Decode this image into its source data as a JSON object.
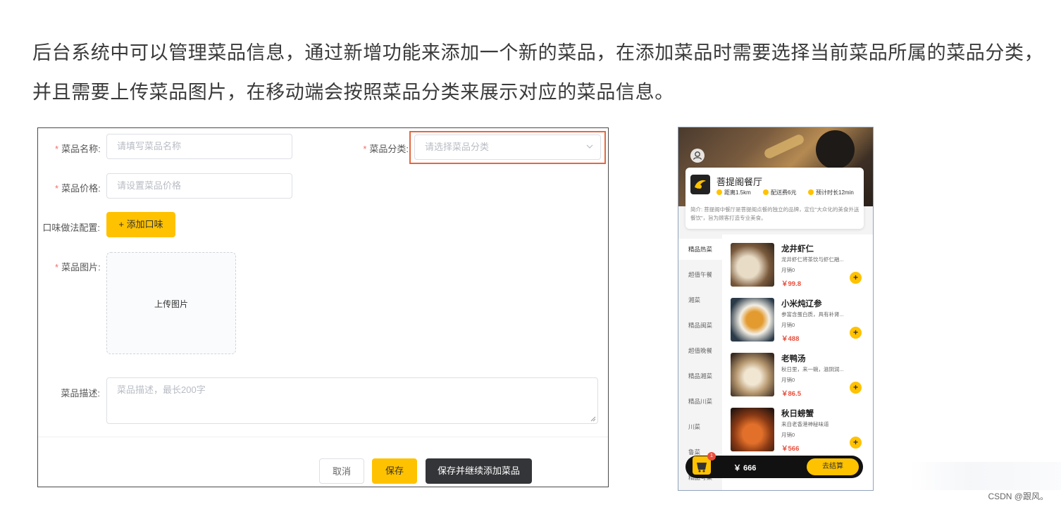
{
  "intro": {
    "line1": "后台系统中可以管理菜品信息，通过新增功能来添加一个新的菜品，在添加菜品时需要选择当前菜品所属的菜品分类，",
    "line2": "并且需要上传菜品图片，在移动端会按照菜品分类来展示对应的菜品信息。"
  },
  "form": {
    "name_label": "菜品名称:",
    "name_placeholder": "请填写菜品名称",
    "category_label": "菜品分类:",
    "category_placeholder": "请选择菜品分类",
    "price_label": "菜品价格:",
    "price_placeholder": "请设置菜品价格",
    "flavor_label": "口味做法配置:",
    "add_flavor_button": "+ 添加口味",
    "image_label": "菜品图片:",
    "upload_text": "上传图片",
    "desc_label": "菜品描述:",
    "desc_placeholder": "菜品描述，最长200字",
    "cancel_button": "取消",
    "save_button": "保存",
    "save_continue_button": "保存并继续添加菜品",
    "required_mark": "*"
  },
  "mobile": {
    "shop_name": "菩提阁餐厅",
    "distance": "距离1.5km",
    "delivery_fee": "配送费6元",
    "eta": "预计时长12min",
    "intro_text": "简介: 菩提阁中餐厅是菩提阁点餐的独立的品牌，定位\"大众化的美食外送餐饮\"，旨为顾客打造专业美食。",
    "categories": [
      "精品热菜",
      "超值午餐",
      "湘菜",
      "精品闽菜",
      "超值晚餐",
      "精品湘菜",
      "精品川菜",
      "川菜",
      "鲁菜",
      "精品粤菜"
    ],
    "dishes": [
      {
        "name": "龙井虾仁",
        "desc": "龙井虾仁将茶饮与虾仁融...",
        "sold": "月销0",
        "price": "￥99.8"
      },
      {
        "name": "小米炖辽参",
        "desc": "参富含蛋白质，具有补肾...",
        "sold": "月销0",
        "price": "￥488"
      },
      {
        "name": "老鸭汤",
        "desc": "秋日里，来一碗，滋阴润...",
        "sold": "月销0",
        "price": "￥86.5"
      },
      {
        "name": "秋日螃蟹",
        "desc": "来自老香港神秘味道",
        "sold": "月销0",
        "price": "￥566"
      }
    ],
    "plus_symbol": "+",
    "cart_count": "1",
    "cart_total": "￥ 666",
    "checkout_button": "去结算"
  },
  "watermark": "CSDN @跟风。",
  "colors": {
    "accent": "#ffc200",
    "highlight_border": "#e4683f",
    "price": "#e94e3c"
  }
}
